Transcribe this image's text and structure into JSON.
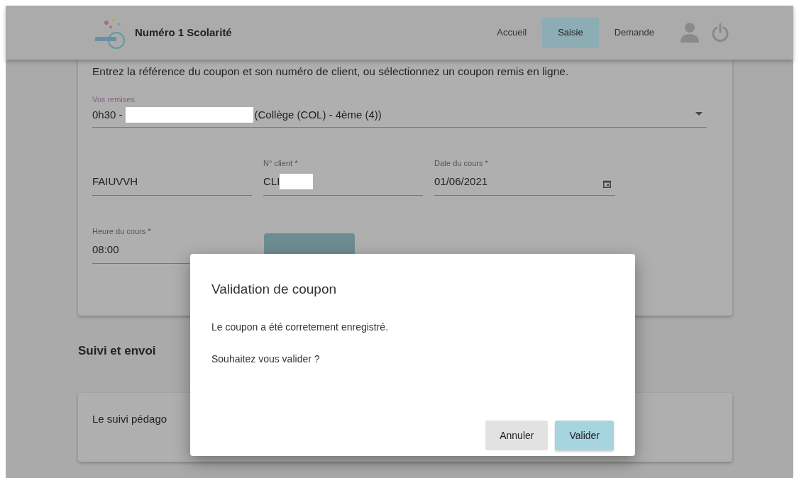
{
  "navbar": {
    "brand": "Numéro 1 Scolarité",
    "items": [
      {
        "label": "Accueil",
        "selected": false
      },
      {
        "label": "Saisie",
        "selected": true
      },
      {
        "label": "Demande",
        "selected": false
      }
    ]
  },
  "coupon_card": {
    "intro": "Entrez la référence du coupon et son numéro de client, ou sélectionnez un coupon remis en ligne.",
    "remises": {
      "label": "Vos remises",
      "value_start": "0h30 -",
      "redacted": true,
      "value_end": "(Collège (COL) - 4ème (4))"
    },
    "reference": {
      "value": "FAIUVVH"
    },
    "client": {
      "label": "N° client *",
      "value": "CLI",
      "redacted": true
    },
    "date": {
      "label": "Date du cours *",
      "value": "01/06/2021"
    },
    "heure": {
      "label": "Heure du cours *",
      "value": "08:00"
    }
  },
  "suivi": {
    "heading": "Suivi et envoi",
    "text": "Le suivi pédago"
  },
  "dialog": {
    "title": "Validation de coupon",
    "messages": [
      "Le coupon a été corretement enregistré.",
      "Souhaitez vous valider ?"
    ],
    "buttons": [
      {
        "label": "Annuler",
        "kind": "secondary"
      },
      {
        "label": "Valider",
        "kind": "primary"
      }
    ]
  }
}
